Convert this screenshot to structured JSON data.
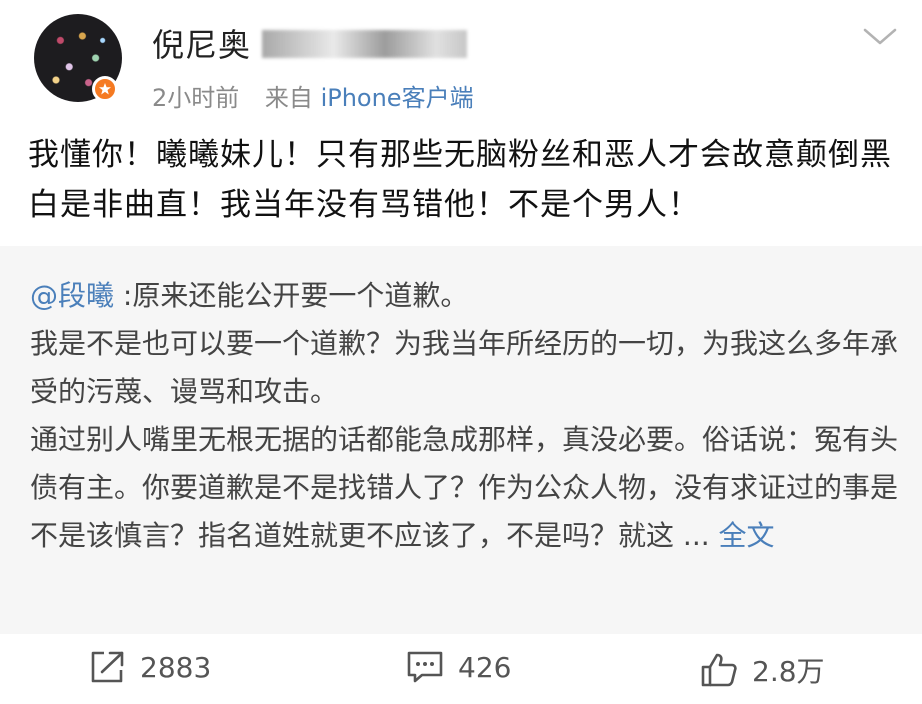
{
  "header": {
    "username": "倪尼奥",
    "time": "2小时前",
    "from_prefix": "来自",
    "source": "iPhone客户端"
  },
  "post": {
    "text": "我懂你！曦曦妹儿！只有那些无脑粉丝和恶人才会故意颠倒黑白是非曲直！我当年没有骂错他！不是个男人！"
  },
  "repost": {
    "mention": "@段曦",
    "lead": " :原来还能公开要一个道歉。",
    "para1": "我是不是也可以要一个道歉？为我当年所经历的一切，为我这么多年承受的污蔑、谩骂和攻击。",
    "para2": "通过别人嘴里无根无据的话都能急成那样，真没必要。俗话说：冤有头债有主。你要道歉是不是找错人了？作为公众人物，没有求证过的事是不是该慎言？指名道姓就更不应该了，不是吗？就这",
    "ellipsis": " ... ",
    "more": "全文"
  },
  "footer": {
    "repost_count": "2883",
    "comment_count": "426",
    "like_count": "2.8万"
  },
  "icons": {
    "badge": "verified-badge-icon",
    "expand": "chevron-down-icon",
    "repost": "share-icon",
    "comment": "comment-icon",
    "like": "thumbs-up-icon"
  },
  "colors": {
    "link": "#4a7fba",
    "badge": "#f57a22",
    "repost_bg": "#f6f6f6"
  }
}
